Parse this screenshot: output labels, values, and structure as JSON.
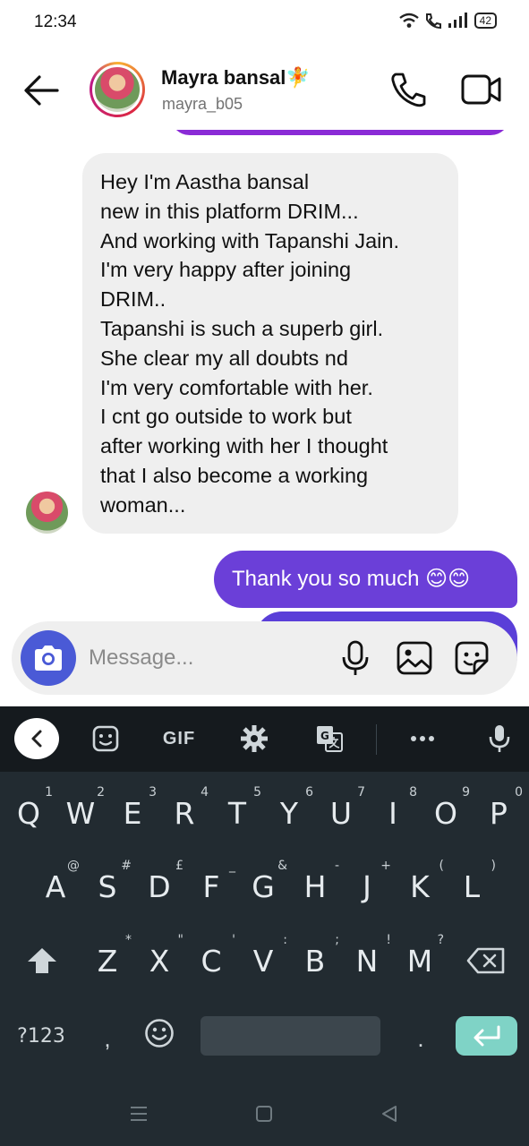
{
  "status_bar": {
    "time": "12:34",
    "battery": "42"
  },
  "header": {
    "contact_name": "Mayra bansal🧚",
    "contact_handle": "mayra_b05"
  },
  "messages": {
    "received": [
      "Hey I'm Aastha bansal",
      "new in this platform DRIM...",
      "And working with Tapanshi Jain.",
      "I'm very happy after joining",
      "DRIM..",
      "Tapanshi is such a superb girl.",
      "She clear my all doubts nd",
      "I'm very comfortable with her.",
      "I cnt go outside to work but",
      "after working with her I thought",
      "that I also become a working",
      "woman..."
    ],
    "sent": "Thank you so much 😊😊"
  },
  "composer": {
    "placeholder": "Message..."
  },
  "keyboard": {
    "toolbar": {
      "gif": "GIF"
    },
    "row1": [
      {
        "key": "Q",
        "hint": "1"
      },
      {
        "key": "W",
        "hint": "2"
      },
      {
        "key": "E",
        "hint": "3"
      },
      {
        "key": "R",
        "hint": "4"
      },
      {
        "key": "T",
        "hint": "5"
      },
      {
        "key": "Y",
        "hint": "6"
      },
      {
        "key": "U",
        "hint": "7"
      },
      {
        "key": "I",
        "hint": "8"
      },
      {
        "key": "O",
        "hint": "9"
      },
      {
        "key": "P",
        "hint": "0"
      }
    ],
    "row2": [
      {
        "key": "A",
        "hint": "@"
      },
      {
        "key": "S",
        "hint": "#"
      },
      {
        "key": "D",
        "hint": "£"
      },
      {
        "key": "F",
        "hint": "_"
      },
      {
        "key": "G",
        "hint": "&"
      },
      {
        "key": "H",
        "hint": "-"
      },
      {
        "key": "J",
        "hint": "+"
      },
      {
        "key": "K",
        "hint": "("
      },
      {
        "key": "L",
        "hint": ")"
      }
    ],
    "row3": [
      {
        "key": "Z",
        "hint": "*"
      },
      {
        "key": "X",
        "hint": "\""
      },
      {
        "key": "C",
        "hint": "'"
      },
      {
        "key": "V",
        "hint": ":"
      },
      {
        "key": "B",
        "hint": ";"
      },
      {
        "key": "N",
        "hint": "!"
      },
      {
        "key": "M",
        "hint": "?"
      }
    ],
    "symbols_label": "?123",
    "comma": ",",
    "period": "."
  },
  "colors": {
    "sent_bubble": "#6b3fd8",
    "received_bubble": "#efefef",
    "keyboard_bg": "#222b31",
    "enter_key": "#7fd3c6"
  }
}
